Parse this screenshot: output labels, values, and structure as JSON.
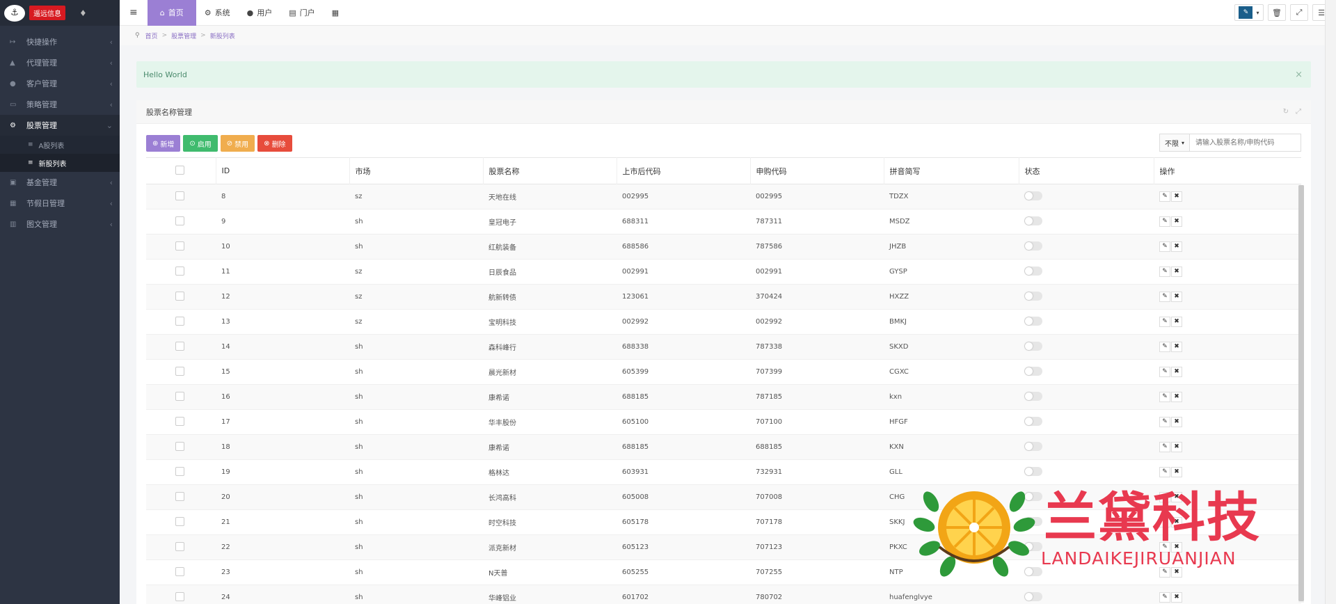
{
  "app": {
    "brand": "遥远信息",
    "logo": "logo-mark"
  },
  "sidebar": {
    "items": [
      {
        "label": "快捷操作",
        "icon": "shortcut-icon"
      },
      {
        "label": "代理管理",
        "icon": "group-icon"
      },
      {
        "label": "客户管理",
        "icon": "user-icon"
      },
      {
        "label": "策略管理",
        "icon": "strategy-icon"
      },
      {
        "label": "股票管理",
        "icon": "stock-icon",
        "active": true,
        "subitems": [
          {
            "label": "A股列表"
          },
          {
            "label": "新股列表",
            "active": true
          }
        ]
      },
      {
        "label": "基金管理",
        "icon": "fund-icon"
      },
      {
        "label": "节假日管理",
        "icon": "calendar-icon"
      },
      {
        "label": "图文管理",
        "icon": "image-text-icon"
      }
    ]
  },
  "topbar": {
    "tabs": [
      {
        "label": "首页",
        "icon": "home-icon"
      },
      {
        "label": "系统",
        "icon": "gear-icon"
      },
      {
        "label": "用户",
        "icon": "user-icon"
      },
      {
        "label": "门户",
        "icon": "portal-icon"
      }
    ]
  },
  "breadcrumb": [
    "首页",
    "股票管理",
    "新股列表"
  ],
  "alert": {
    "text": "Hello World"
  },
  "panel": {
    "title": "股票名称管理"
  },
  "toolbar": {
    "add": "新增",
    "enable": "启用",
    "disable": "禁用",
    "delete": "删除"
  },
  "filter": {
    "select": "不限",
    "placeholder": "请输入股票名称/申购代码"
  },
  "table": {
    "headers": [
      "ID",
      "市场",
      "股票名称",
      "上市后代码",
      "申购代码",
      "拼音简写",
      "状态",
      "操作"
    ],
    "rows": [
      [
        "8",
        "sz",
        "天地在线",
        "002995",
        "002995",
        "TDZX"
      ],
      [
        "9",
        "sh",
        "皇冠电子",
        "688311",
        "787311",
        "MSDZ"
      ],
      [
        "10",
        "sh",
        "红航装备",
        "688586",
        "787586",
        "JHZB"
      ],
      [
        "11",
        "sz",
        "日辰食品",
        "002991",
        "002991",
        "GYSP"
      ],
      [
        "12",
        "sz",
        "航新转债",
        "123061",
        "370424",
        "HXZZ"
      ],
      [
        "13",
        "sz",
        "宝明科技",
        "002992",
        "002992",
        "BMKJ"
      ],
      [
        "14",
        "sh",
        "森科峰行",
        "688338",
        "787338",
        "SKXD"
      ],
      [
        "15",
        "sh",
        "晨光新材",
        "605399",
        "707399",
        "CGXC"
      ],
      [
        "16",
        "sh",
        "康希诺",
        "688185",
        "787185",
        "kxn"
      ],
      [
        "17",
        "sh",
        "华丰股份",
        "605100",
        "707100",
        "HFGF"
      ],
      [
        "18",
        "sh",
        "康希诺",
        "688185",
        "688185",
        "KXN"
      ],
      [
        "19",
        "sh",
        "格林达",
        "603931",
        "732931",
        "GLL"
      ],
      [
        "20",
        "sh",
        "长鸿高科",
        "605008",
        "707008",
        "CHG"
      ],
      [
        "21",
        "sh",
        "时空科技",
        "605178",
        "707178",
        "SKKJ"
      ],
      [
        "22",
        "sh",
        "派克新材",
        "605123",
        "707123",
        "PKXC"
      ],
      [
        "23",
        "sh",
        "N天普",
        "605255",
        "707255",
        "NTP"
      ],
      [
        "24",
        "sh",
        "华峰铝业",
        "601702",
        "780702",
        "huafenglvye"
      ]
    ]
  },
  "watermark": {
    "title": "兰黛科技",
    "subtitle": "LANDAIKEJIRUANJIAN"
  }
}
